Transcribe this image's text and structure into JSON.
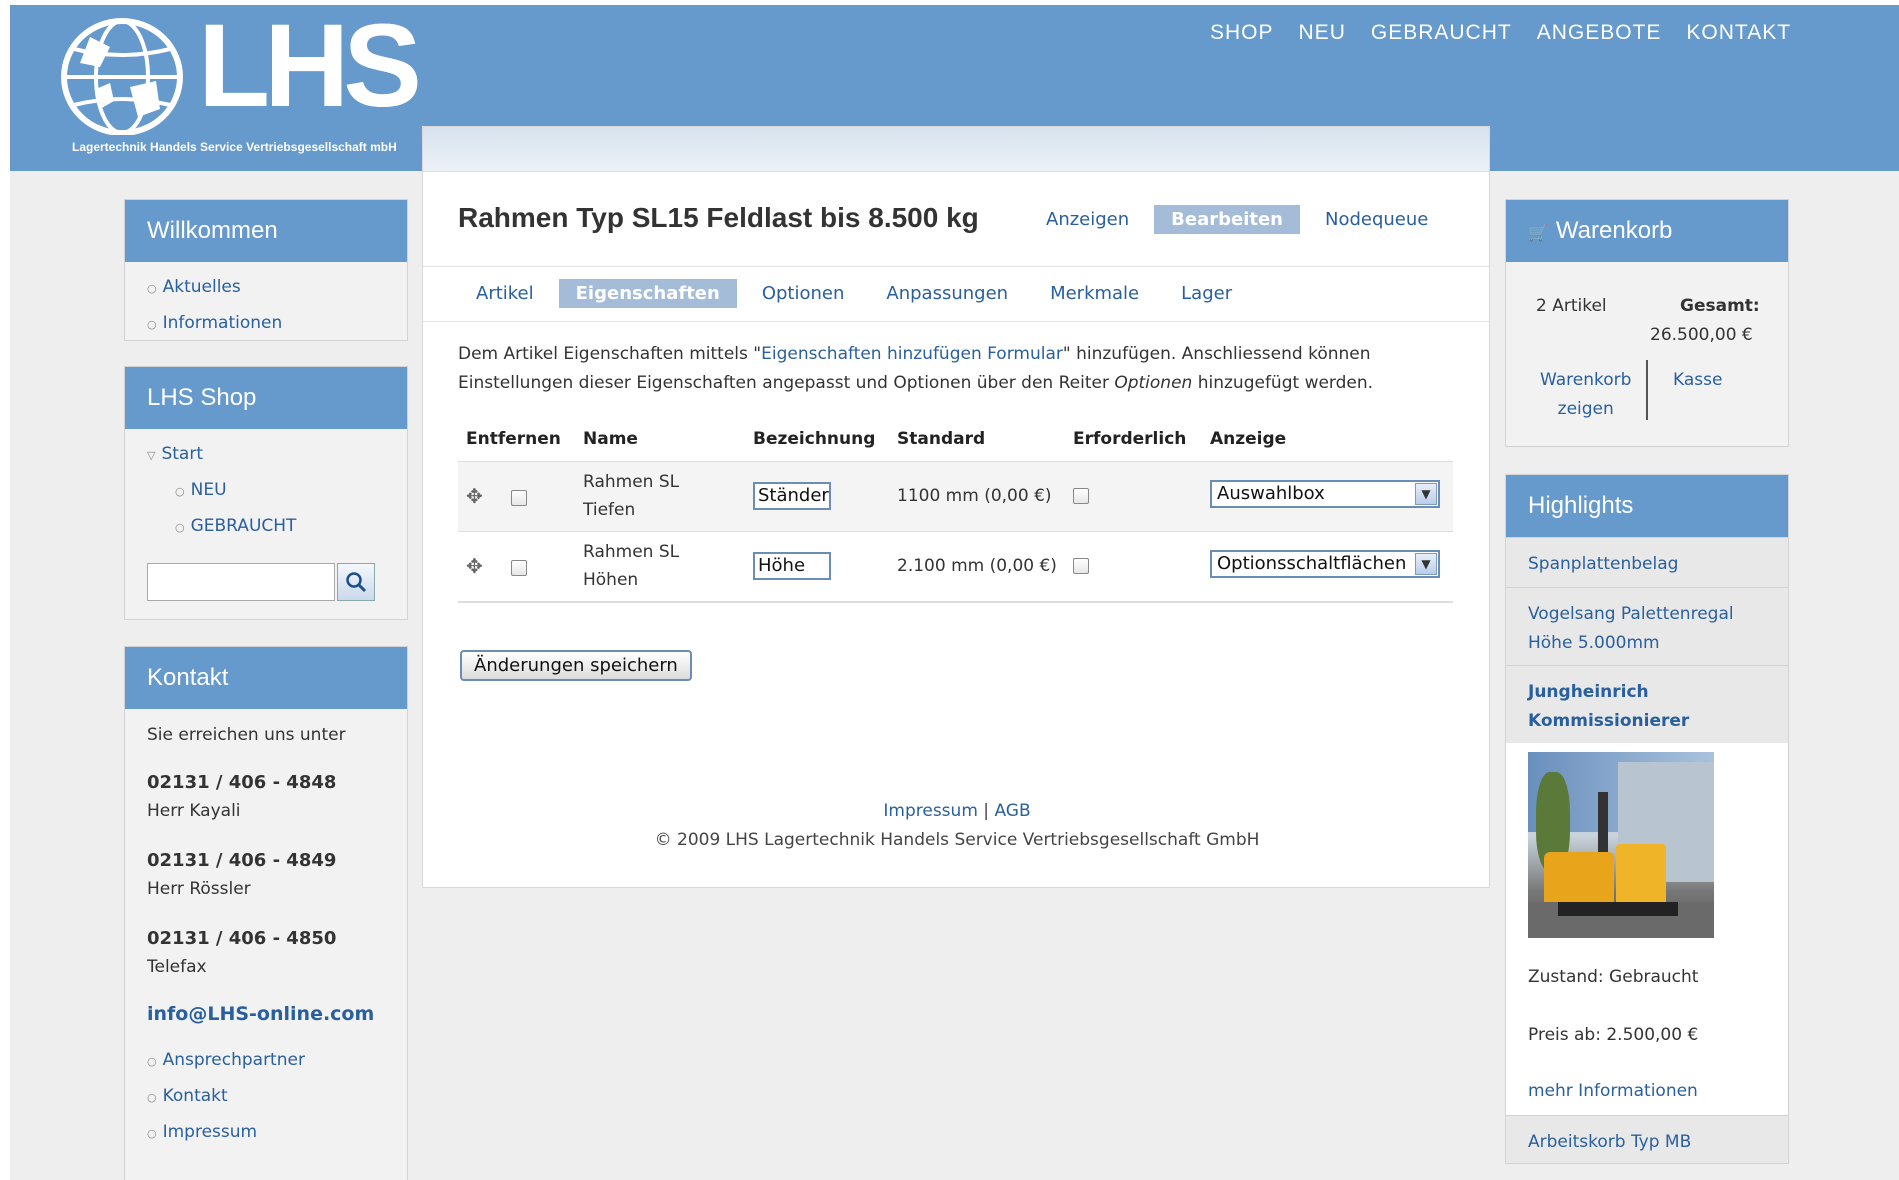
{
  "header": {
    "logo_text": "LHS",
    "logo_tagline": "Lagertechnik Handels Service Vertriebsgesellschaft mbH",
    "nav": [
      "SHOP",
      "NEU",
      "GEBRAUCHT",
      "ANGEBOTE",
      "KONTAKT"
    ]
  },
  "left": {
    "welcome": {
      "title": "Willkommen",
      "items": [
        "Aktuelles",
        "Informationen"
      ]
    },
    "shop": {
      "title": "LHS Shop",
      "start": "Start",
      "items": [
        "NEU",
        "GEBRAUCHT"
      ],
      "search_value": ""
    },
    "contact": {
      "title": "Kontakt",
      "intro": "Sie erreichen uns unter",
      "entries": [
        {
          "phone": "02131 / 406 - 4848",
          "name": "Herr Kayali"
        },
        {
          "phone": "02131 / 406 - 4849",
          "name": "Herr Rössler"
        },
        {
          "phone": "02131 / 406 - 4850",
          "name": "Telefax"
        }
      ],
      "email": "info@LHS-online.com",
      "links": [
        "Ansprechpartner",
        "Kontakt",
        "Impressum"
      ]
    }
  },
  "main": {
    "title": "Rahmen Typ SL15 Feldlast bis 8.500 kg",
    "tabs": [
      {
        "label": "Anzeigen",
        "active": false
      },
      {
        "label": "Bearbeiten",
        "active": true
      },
      {
        "label": "Nodequeue",
        "active": false
      }
    ],
    "subtabs": [
      {
        "label": "Artikel",
        "active": false
      },
      {
        "label": "Eigenschaften",
        "active": true
      },
      {
        "label": "Optionen",
        "active": false
      },
      {
        "label": "Anpassungen",
        "active": false
      },
      {
        "label": "Merkmale",
        "active": false
      },
      {
        "label": "Lager",
        "active": false
      }
    ],
    "desc_part1": "Dem Artikel Eigenschaften mittels \"",
    "desc_link": "Eigenschaften hinzufügen Formular",
    "desc_part2": "\" hinzufügen. Anschliessend können Einstellungen dieser Eigenschaften angepasst und Optionen über den Reiter ",
    "desc_em": "Optionen",
    "desc_part3": " hinzugefügt werden.",
    "table": {
      "headers": [
        "Entfernen",
        "Name",
        "Bezeichnung",
        "Standard",
        "Erforderlich",
        "Anzeige"
      ],
      "rows": [
        {
          "name_line1": "Rahmen SL",
          "name_line2": "Tiefen",
          "label": "Ständer",
          "default": "1100 mm (0,00 €)",
          "display": "Auswahlbox"
        },
        {
          "name_line1": "Rahmen SL",
          "name_line2": "Höhen",
          "label": "Höhe",
          "default": "2.100 mm (0,00 €)",
          "display": "Optionsschaltflächen"
        }
      ]
    },
    "save_label": "Änderungen speichern",
    "footer_impressum": "Impressum",
    "footer_sep": "|",
    "footer_agb": "AGB",
    "footer_copyright": "© 2009 LHS Lagertechnik Handels Service Vertriebsgesellschaft GmbH"
  },
  "right": {
    "cart": {
      "title": "Warenkorb",
      "count": "2 Artikel",
      "total_label": "Gesamt:",
      "total_value": "26.500,00 €",
      "show_line1": "Warenkorb",
      "show_line2": "zeigen",
      "checkout": "Kasse"
    },
    "highlights": {
      "title": "Highlights",
      "item1": "Spanplattenbelag",
      "item2_line1": "Vogelsang Palettenregal",
      "item2_line2": "Höhe 5.000mm",
      "featured_line1": "Jungheinrich",
      "featured_line2": "Kommissionierer",
      "condition": "Zustand: Gebraucht",
      "price": "Preis ab: 2.500,00 €",
      "more": "mehr Informationen",
      "item4": "Arbeitskorb Typ MB"
    }
  },
  "colors": {
    "header_blue": "#6699cc",
    "active_tab": "#a4bcd8",
    "link": "#2a5f9e"
  }
}
